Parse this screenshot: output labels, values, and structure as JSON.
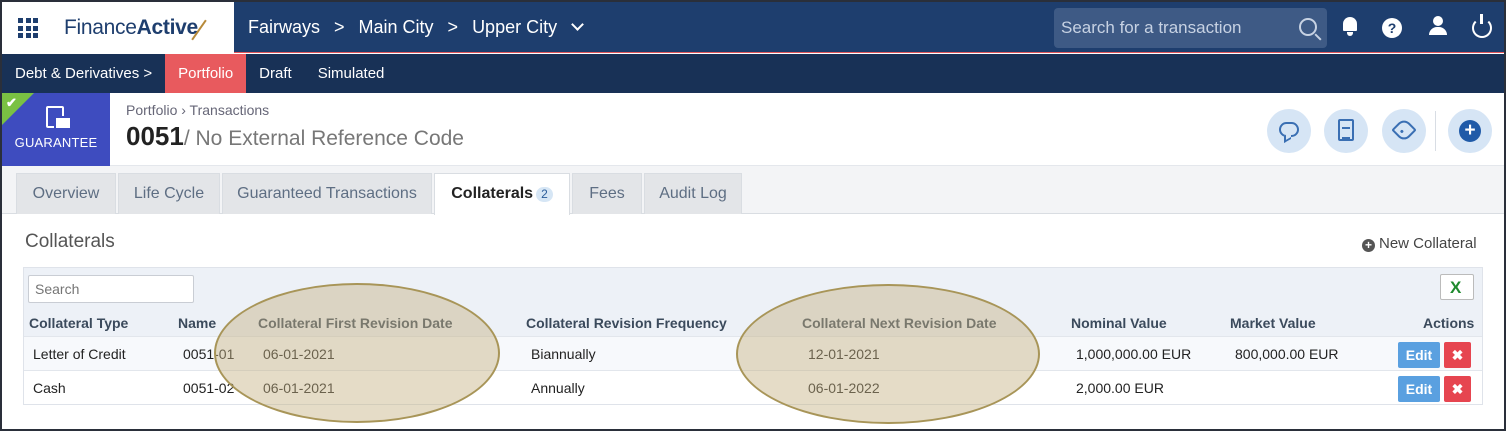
{
  "app": {
    "logo_regular": "Finance",
    "logo_bold": "Active",
    "breadcrumb": [
      "Fairways",
      "Main City",
      "Upper City"
    ],
    "search_placeholder": "Search for a transaction",
    "help_label": "?"
  },
  "subnav": {
    "items": [
      {
        "label": "Debt & Derivatives >",
        "active": false
      },
      {
        "label": "Portfolio",
        "active": true
      },
      {
        "label": "Draft",
        "active": false
      },
      {
        "label": "Simulated",
        "active": false
      }
    ]
  },
  "header": {
    "badge_label": "GUARANTEE",
    "breadcrumb": "Portfolio › Transactions",
    "title_code": "0051",
    "title_sub": "/ No External Reference Code"
  },
  "tabs": [
    {
      "label": "Overview"
    },
    {
      "label": "Life Cycle"
    },
    {
      "label": "Guaranteed Transactions"
    },
    {
      "label": "Collaterals",
      "count": "2",
      "active": true
    },
    {
      "label": "Fees"
    },
    {
      "label": "Audit Log"
    }
  ],
  "collaterals": {
    "section_title": "Collaterals",
    "new_label": "New Collateral",
    "search_placeholder": "Search",
    "columns": [
      "Collateral Type",
      "Name",
      "Collateral First Revision Date",
      "Collateral Revision Frequency",
      "Collateral Next Revision Date",
      "Nominal Value",
      "Market Value",
      "Actions"
    ],
    "rows": [
      {
        "type": "Letter of Credit",
        "name": "0051-01",
        "first_revision": "06-01-2021",
        "frequency": "Biannually",
        "next_revision": "12-01-2021",
        "nominal": "1,000,000.00 EUR",
        "market": "800,000.00 EUR"
      },
      {
        "type": "Cash",
        "name": "0051-02",
        "first_revision": "06-01-2021",
        "frequency": "Annually",
        "next_revision": "06-01-2022",
        "nominal": "2,000.00 EUR",
        "market": ""
      }
    ],
    "edit_label": "Edit",
    "delete_label": "✖"
  },
  "colors": {
    "topbar": "#1e3e6e",
    "subnav": "#183156",
    "active_tab": "#e85a5e",
    "badge": "#3e4cbf",
    "edit": "#5aa0e0",
    "delete": "#e64550"
  }
}
